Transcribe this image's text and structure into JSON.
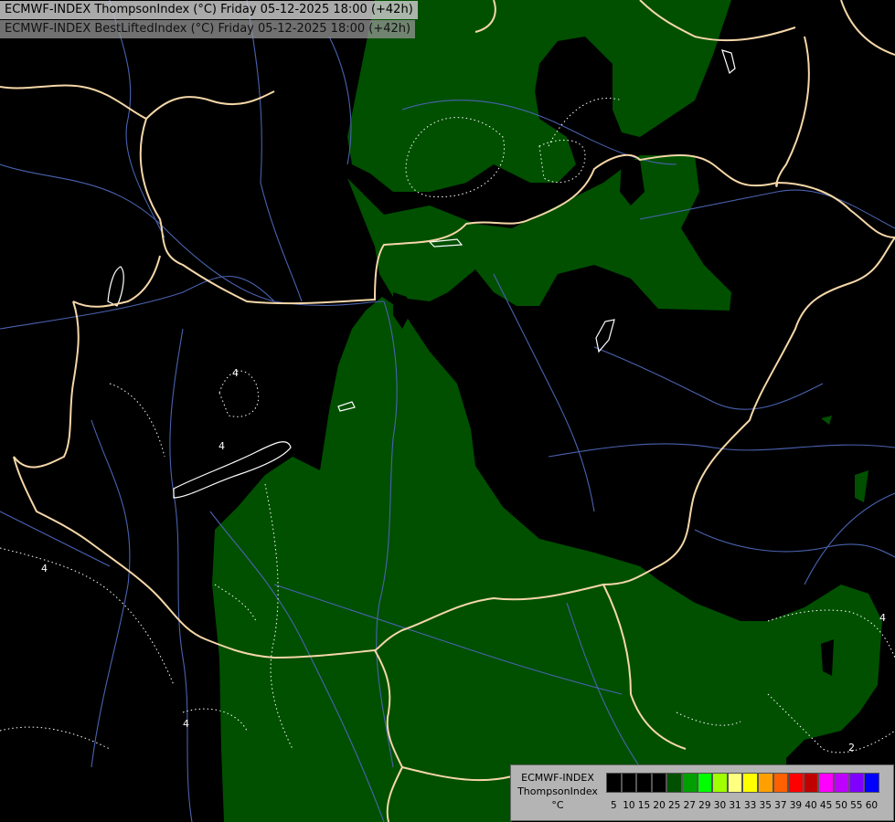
{
  "header": {
    "line1": "ECMWF-INDEX ThompsonIndex (°C) Friday 05-12-2025 18:00 (+42h)",
    "line2": "ECMWF-INDEX BestLiftedIndex (°C) Friday 05-12-2025 18:00 (+42h)"
  },
  "map": {
    "contour_label": "4",
    "contour_label_2": "2",
    "colors": {
      "background": "#000000",
      "thompson_fill": "#005000",
      "border": "#f5d7a8",
      "river": "#4a62b0",
      "contour": "#ffffff"
    }
  },
  "legend": {
    "product": "ECMWF-INDEX",
    "variable": "ThompsonIndex",
    "unit": "°C",
    "ticks": [
      "5",
      "10",
      "15",
      "20",
      "25",
      "27",
      "29",
      "30",
      "31",
      "33",
      "35",
      "37",
      "39",
      "40",
      "45",
      "50",
      "55",
      "60"
    ],
    "colors": [
      "#000000",
      "#000000",
      "#000000",
      "#000000",
      "#005000",
      "#00a000",
      "#00ff00",
      "#a0ff00",
      "#ffff80",
      "#ffff00",
      "#ffa000",
      "#ff6000",
      "#ff0000",
      "#c00000",
      "#ff00ff",
      "#c000ff",
      "#8000ff",
      "#0000ff"
    ]
  }
}
